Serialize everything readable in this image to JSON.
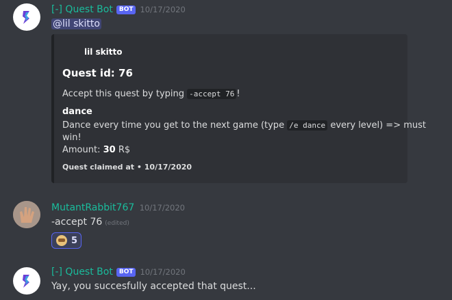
{
  "messages": [
    {
      "username": "[-] Quest Bot",
      "bot_tag": "BOT",
      "timestamp": "10/17/2020",
      "mention": "@lil skitto",
      "embed": {
        "author": "lil skitto",
        "title": "Quest id: 76",
        "desc_prefix": "Accept this quest by typing",
        "desc_code": "-accept 76",
        "desc_suffix": "!",
        "field_name": "dance",
        "field_line1_prefix": "Dance every time you get to the next game (type",
        "field_line1_code": "/e dance",
        "field_line1_suffix": "every level) => must",
        "field_line2": "win!",
        "amount_label": "Amount:",
        "amount_value": "30",
        "amount_unit": "R$",
        "footer": "Quest claimed at • 10/17/2020"
      }
    },
    {
      "username": "MutantRabbit767",
      "timestamp": "10/17/2020",
      "text": "-accept 76",
      "edited": "(edited)",
      "reaction_count": "5"
    },
    {
      "username": "[-] Quest Bot",
      "bot_tag": "BOT",
      "timestamp": "10/17/2020",
      "text": "Yay, you succesfully accepted that quest..."
    }
  ],
  "colors": {
    "background": "#36393f",
    "embed_bg": "#2f3136",
    "username": "#1abc9c",
    "bot_tag": "#5865f2"
  },
  "icons": {
    "bot_avatar": "purple-flame-logo",
    "reaction": "face-emoji"
  }
}
